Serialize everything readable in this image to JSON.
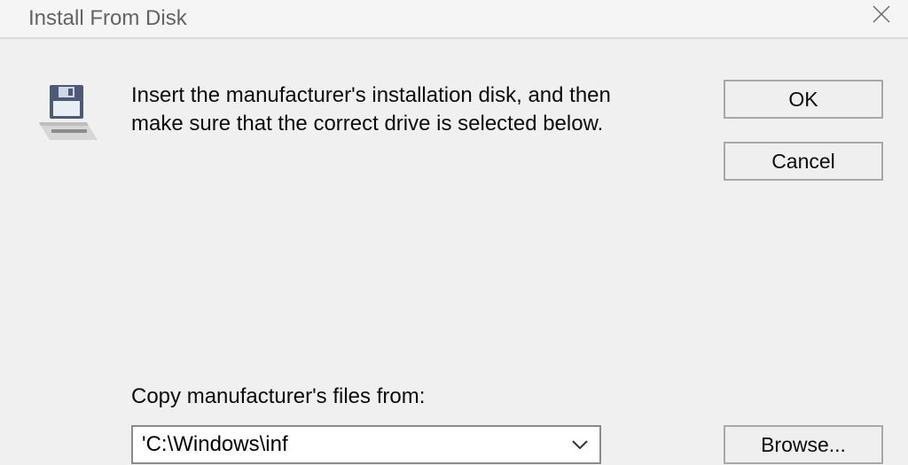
{
  "window": {
    "title": "Install From Disk"
  },
  "instruction": "Insert the manufacturer's installation disk, and then make sure that the correct drive is selected below.",
  "buttons": {
    "ok": "OK",
    "cancel": "Cancel",
    "browse": "Browse..."
  },
  "copy_from": {
    "label": "Copy manufacturer's files from:",
    "value": "'C:\\Windows\\inf"
  },
  "icons": {
    "disk": "floppy-disk-icon",
    "close": "close-icon",
    "dropdown": "chevron-down-icon"
  }
}
